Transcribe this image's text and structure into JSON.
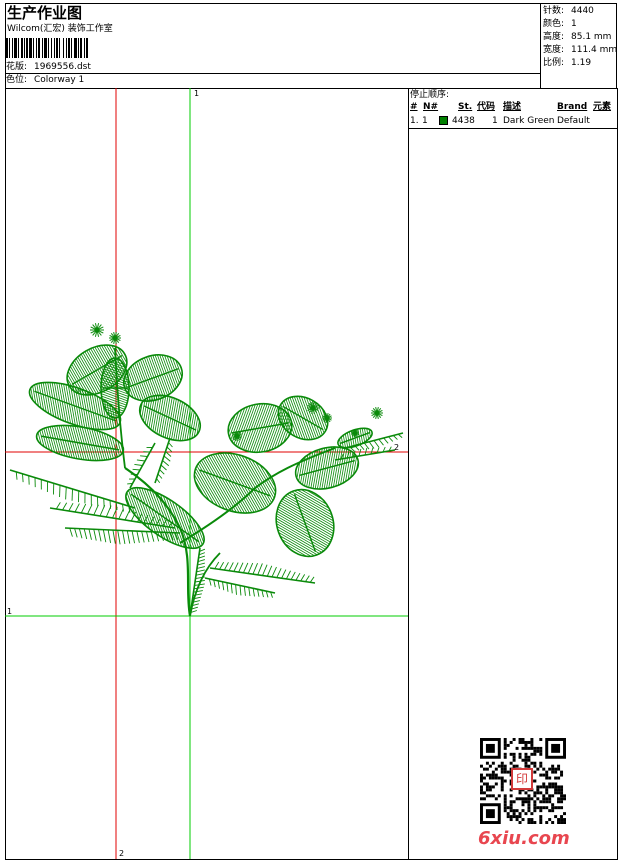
{
  "header": {
    "title": "生产作业图",
    "company": "Wilcom(汇宏) 装饰工作室",
    "design_file_label": "花版:",
    "design_file": "1969556.dst",
    "colorway_label": "色位:",
    "colorway": "Colorway 1"
  },
  "stats": {
    "stitches_label": "针数:",
    "stitches": "4440",
    "colors_label": "颜色:",
    "colors": "1",
    "height_label": "高度:",
    "height": "85.1 mm",
    "width_label": "宽度:",
    "width": "111.4 mm",
    "scale_label": "比例:",
    "scale": "1.19"
  },
  "stop_sequence": {
    "title": "停止顺序:",
    "columns": [
      "#",
      "N#",
      "St.",
      "代码",
      "描述",
      "Brand",
      "元素"
    ],
    "rows": [
      {
        "num": "1.",
        "n": "1",
        "swatch": "#008000",
        "code": "4438",
        "stitches_col": "1",
        "description": "Dark Green",
        "brand": "Default",
        "element": ""
      }
    ]
  },
  "guides": {
    "v1_label": "1",
    "v2_label": "2",
    "h1_label": "1",
    "h2_label": "2",
    "color_1": "#00cc00",
    "color_2": "#e00000"
  },
  "thread_color": "#0a8a0a",
  "watermark": "6xiu.com",
  "seal_text": "印"
}
